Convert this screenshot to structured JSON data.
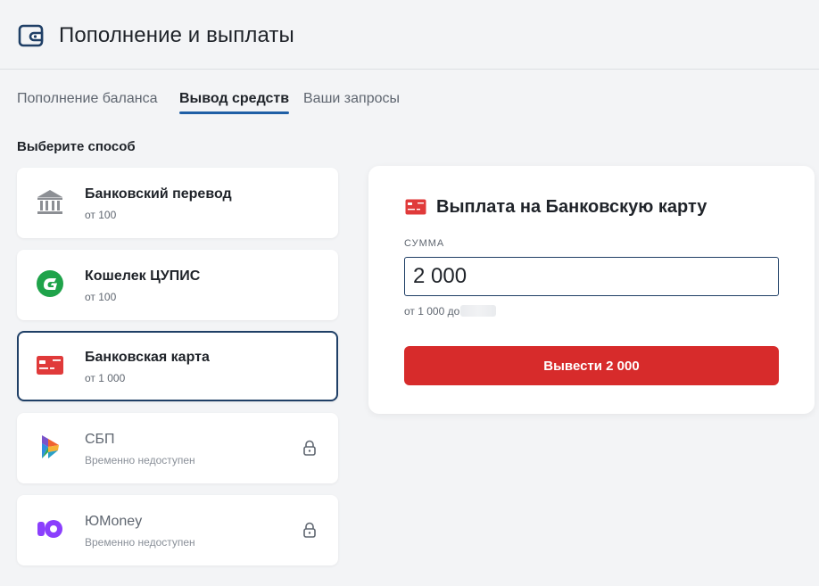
{
  "header": {
    "title": "Пополнение и выплаты",
    "icon": "wallet-icon"
  },
  "tabs": [
    {
      "label": "Пополнение баланса",
      "active": false
    },
    {
      "label": "Вывод средств",
      "active": true
    },
    {
      "label": "Ваши запросы",
      "active": false
    }
  ],
  "methods_section": {
    "label": "Выберите способ",
    "items": [
      {
        "name": "Банковский перевод",
        "sub": "от 100",
        "icon": "bank-icon",
        "state": "available"
      },
      {
        "name": "Кошелек ЦУПИС",
        "sub": "от 100",
        "icon": "cupis-wallet-icon",
        "state": "available"
      },
      {
        "name": "Банковская карта",
        "sub": "от 1 000",
        "icon": "bank-card-icon",
        "state": "selected"
      },
      {
        "name": "СБП",
        "sub": "Временно недоступен",
        "icon": "sbp-icon",
        "state": "disabled"
      },
      {
        "name": "ЮMoney",
        "sub": "Временно недоступен",
        "icon": "yoomoney-icon",
        "state": "disabled"
      }
    ]
  },
  "payout_panel": {
    "title": "Выплата на Банковскую карту",
    "amount_label": "СУММА",
    "amount_value": "2 000",
    "range_hint": "от 1 000 до",
    "submit_label": "Вывести 2 000"
  },
  "colors": {
    "accent_dark_blue": "#1f3f66",
    "tab_underline": "#1f5fa6",
    "submit_red": "#d72b2b",
    "card_red": "#e03a3a",
    "cupis_green": "#1fa34a",
    "yoomoney_purple": "#8b3ffd"
  }
}
